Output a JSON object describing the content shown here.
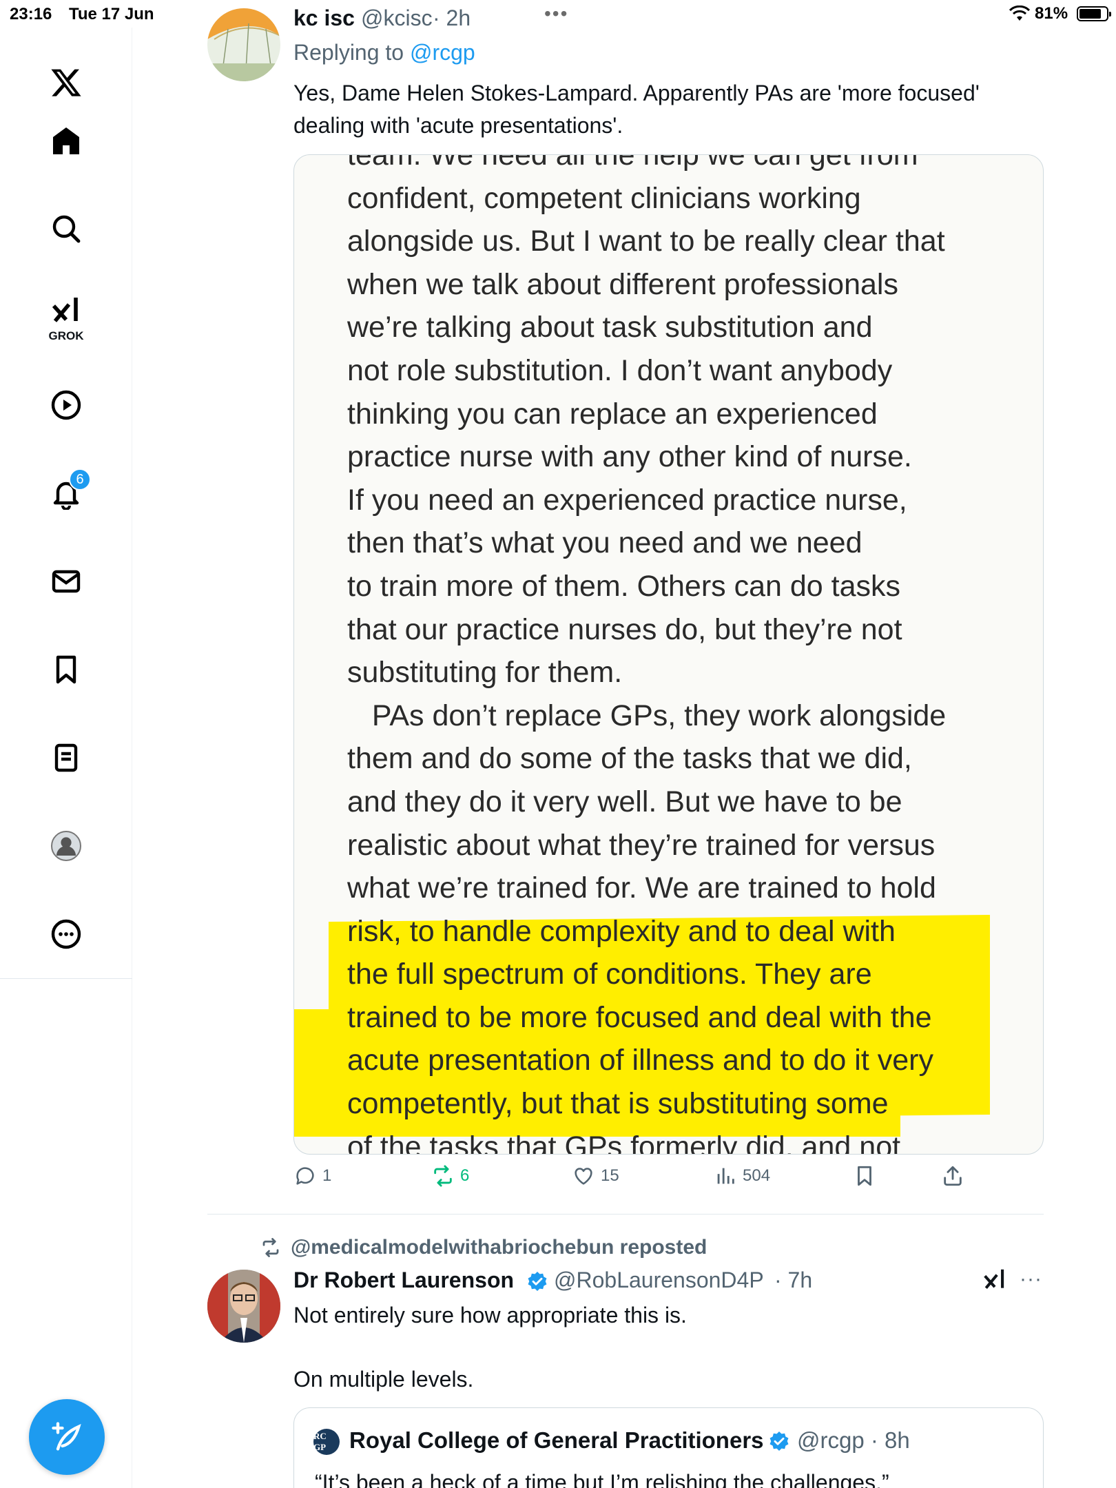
{
  "status_bar": {
    "time": "23:16",
    "date": "Tue 17 Jun",
    "battery": "81%",
    "battery_level": 0.81
  },
  "sidebar": {
    "logo": "x-logo-icon",
    "items": [
      {
        "name": "home",
        "icon": "home-icon"
      },
      {
        "name": "search",
        "icon": "search-icon"
      },
      {
        "name": "grok",
        "icon": "grok-icon",
        "label": "GROK"
      },
      {
        "name": "videos",
        "icon": "play-icon"
      },
      {
        "name": "notifications",
        "icon": "bell-icon",
        "badge": "6"
      },
      {
        "name": "messages",
        "icon": "mail-icon"
      },
      {
        "name": "bookmarks",
        "icon": "bookmark-icon"
      },
      {
        "name": "lists",
        "icon": "list-icon"
      },
      {
        "name": "profile",
        "icon": "profile-icon"
      },
      {
        "name": "more",
        "icon": "more-icon"
      }
    ],
    "compose": "compose-icon"
  },
  "tweet1": {
    "name": "kc isc",
    "handle": "@kcisc",
    "time": "· 2h",
    "replying_prefix": "Replying to",
    "replying_to": "@rcgp",
    "text_line1": "Yes, Dame Helen Stokes-Lampard. Apparently PAs are 'more focused'",
    "text_line2": "dealing with 'acute presentations'.",
    "image_lines": [
      "team. We need all the help we can get from",
      "confident, competent clinicians working",
      "alongside us. But I want to be really clear that",
      "when we talk about different professionals",
      "we’re talking about task substitution and",
      "not role substitution. I don’t want anybody",
      "thinking you can replace an experienced",
      "practice nurse with any other kind of nurse.",
      "If you need an experienced practice nurse,",
      "then that’s what you need and we need",
      "to train more of them. Others can do tasks",
      "that our practice nurses do, but they’re not",
      "substituting for them.",
      "   PAs don’t replace GPs, they work alongside",
      "them and do some of the tasks that we did,",
      "and they do it very well. But we have to be",
      "realistic about what they’re trained for versus",
      "what we’re trained for. We are trained to hold",
      "risk, to handle complexity and to deal with",
      "the full spectrum of conditions. They are",
      "trained to be more focused and deal with the",
      "acute presentation of illness and to do it very",
      "competently, but that is substituting some",
      "of the tasks that GPs formerly did, and not"
    ],
    "replies": "1",
    "reposts": "6",
    "likes": "15",
    "views": "504"
  },
  "tweet2": {
    "reposted_by": "@medicalmodelwithabriochebun reposted",
    "name": "Dr Robert Laurenson",
    "handle": "@RobLaurensonD4P",
    "time": "· 7h",
    "text_line1": "Not entirely sure how appropriate this is.",
    "text_line2": "On multiple levels.",
    "more": "···",
    "quote": {
      "avatar_text": "RC GP",
      "name": "Royal College of General Practitioners",
      "handle": "@rcgp · 8h",
      "text": "“It’s been a heck of a time but I’m relishing the challenges.”"
    }
  },
  "colors": {
    "accent": "#1d9bf0",
    "repost_green": "#00ba7c",
    "muted": "#536471",
    "highlight": "#ffee00"
  }
}
